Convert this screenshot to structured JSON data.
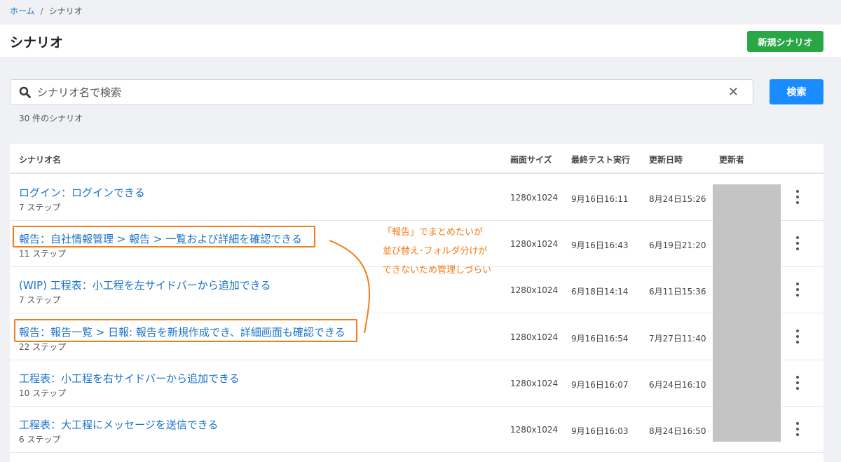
{
  "breadcrumb": {
    "home": "ホーム",
    "separator": "/",
    "current": "シナリオ"
  },
  "page": {
    "title": "シナリオ",
    "new_button": "新規シナリオ"
  },
  "search": {
    "placeholder": "シナリオ名で検索",
    "value": "",
    "button": "検索",
    "clear_icon": "close-icon"
  },
  "count_text": "30 件のシナリオ",
  "table": {
    "headers": {
      "name": "シナリオ名",
      "screen_size": "画面サイズ",
      "last_test": "最終テスト実行",
      "updated_at": "更新日時",
      "updated_by": "更新者"
    },
    "rows": [
      {
        "name": "ログイン：ログインできる",
        "steps": "7 ステップ",
        "screen_size": "1280x1024",
        "last_test": "9月16日16:11",
        "updated_at": "8月24日15:26"
      },
      {
        "name": "報告：自社情報管理 > 報告 > 一覧および詳細を確認できる",
        "steps": "11 ステップ",
        "screen_size": "1280x1024",
        "last_test": "9月16日16:43",
        "updated_at": "6月19日21:20"
      },
      {
        "name": "(WIP) 工程表：小工程を左サイドバーから追加できる",
        "steps": "7 ステップ",
        "screen_size": "1280x1024",
        "last_test": "6月18日14:14",
        "updated_at": "6月11日15:36"
      },
      {
        "name": "報告：報告一覧 > 日報: 報告を新規作成でき、詳細画面も確認できる",
        "steps": "22 ステップ",
        "screen_size": "1280x1024",
        "last_test": "9月16日16:54",
        "updated_at": "7月27日11:40"
      },
      {
        "name": "工程表：小工程を右サイドバーから追加できる",
        "steps": "10 ステップ",
        "screen_size": "1280x1024",
        "last_test": "9月16日16:07",
        "updated_at": "6月24日16:10"
      },
      {
        "name": "工程表：大工程にメッセージを送信できる",
        "steps": "6 ステップ",
        "screen_size": "1280x1024",
        "last_test": "9月16日16:03",
        "updated_at": "8月24日16:50"
      }
    ]
  },
  "annotation": {
    "lines": [
      "「報告」でまとめたいが",
      "並び替え･フォルダ分けが",
      "できないため管理しづらい"
    ],
    "color": "#f07d1a"
  },
  "colors": {
    "link": "#1a73c9",
    "primary": "#1a8cff",
    "success": "#28a745"
  }
}
